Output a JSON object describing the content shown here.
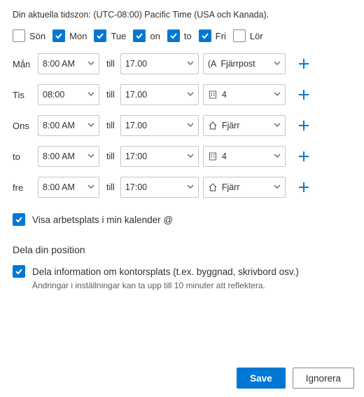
{
  "timezone_line": "Din aktuella tidszon: (UTC-08:00) Pacific Time (USA och Kanada).",
  "days": [
    {
      "label": "Sön",
      "checked": false
    },
    {
      "label": "Mon",
      "checked": true
    },
    {
      "label": "Tue",
      "checked": true
    },
    {
      "label": "on",
      "checked": true
    },
    {
      "label": "to",
      "checked": true
    },
    {
      "label": "Fri",
      "checked": true
    },
    {
      "label": "Lör",
      "checked": false
    }
  ],
  "to_label": "till",
  "rows": [
    {
      "day": "Mån",
      "start": "8:00 AM",
      "end": "17.00",
      "loc_icon": "pin",
      "loc_prefix": "(A",
      "loc_text": "Fjärrpost"
    },
    {
      "day": "Tis",
      "start": "08:00",
      "end": "17.00",
      "loc_icon": "building",
      "loc_prefix": "",
      "loc_text": "4"
    },
    {
      "day": "Ons",
      "start": "8:00 AM",
      "end": "17.00",
      "loc_icon": "home",
      "loc_prefix": "",
      "loc_text": "Fjärr"
    },
    {
      "day": "to",
      "start": "8:00 AM",
      "end": "17:00",
      "loc_icon": "building",
      "loc_prefix": "",
      "loc_text": "4"
    },
    {
      "day": "fre",
      "start": "8:00 AM",
      "end": "17:00",
      "loc_icon": "home",
      "loc_prefix": "",
      "loc_text": "Fjärr"
    }
  ],
  "show_workplace": {
    "checked": true,
    "label": "Visa arbetsplats i min kalender @"
  },
  "share_section_title": "Dela din position",
  "share_location": {
    "checked": true,
    "label": "Dela information om kontorsplats (t.ex. byggnad, skrivbord osv.)",
    "helper": "Ändringar i inställningar kan ta upp till 10 minuter att reflektera."
  },
  "buttons": {
    "save": "Save",
    "cancel": "Ignorera"
  }
}
